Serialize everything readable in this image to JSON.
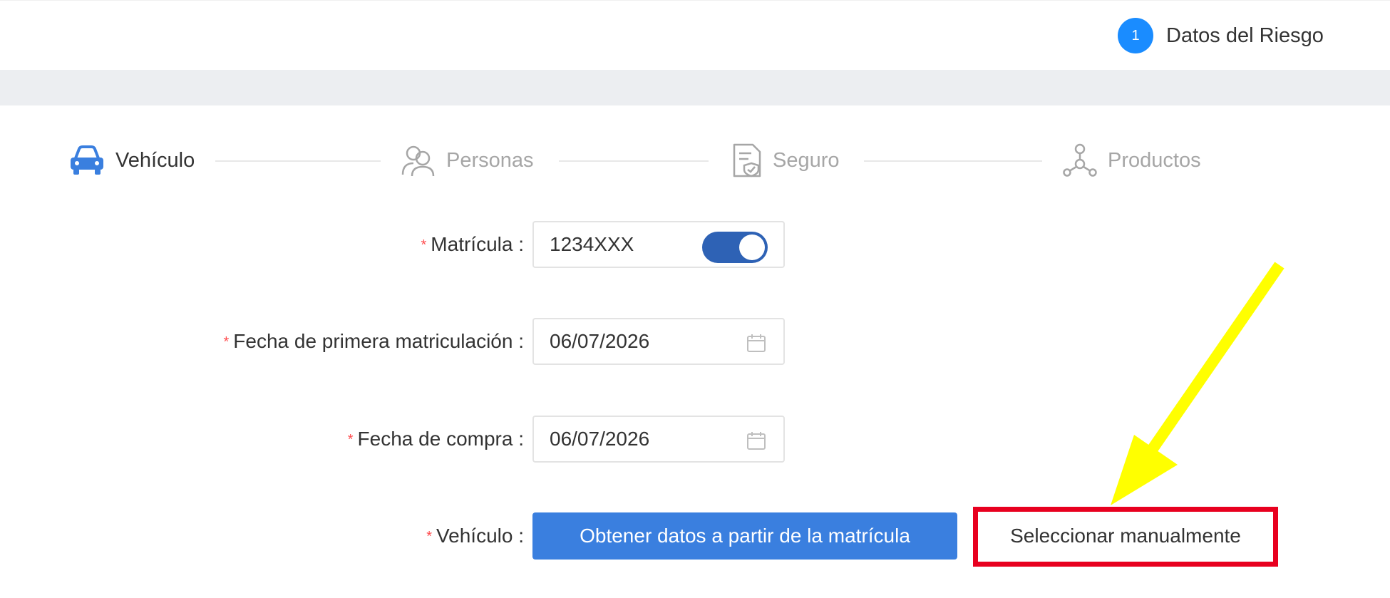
{
  "header": {
    "step_number": "1",
    "step_label": "Datos del Riesgo",
    "accent_color": "#1a8cff"
  },
  "steps": [
    {
      "label": "Vehículo",
      "icon": "car-icon",
      "active": true
    },
    {
      "label": "Personas",
      "icon": "people-icon",
      "active": false
    },
    {
      "label": "Seguro",
      "icon": "insurance-document-icon",
      "active": false
    },
    {
      "label": "Productos",
      "icon": "network-icon",
      "active": false
    }
  ],
  "form": {
    "plate": {
      "label": "Matrícula :",
      "value": "1234XXX",
      "toggle_on": true
    },
    "first_registration": {
      "label": "Fecha de primera matriculación :",
      "value": "06/07/2026"
    },
    "purchase_date": {
      "label": "Fecha de compra :",
      "value": "06/07/2026"
    },
    "vehicle": {
      "label": "Vehículo :",
      "primary_button": "Obtener datos a partir de la matrícula",
      "secondary_button": "Seleccionar manualmente"
    }
  },
  "annotations": {
    "highlight_color": "#e8001f",
    "arrow_color": "#ffff00"
  }
}
